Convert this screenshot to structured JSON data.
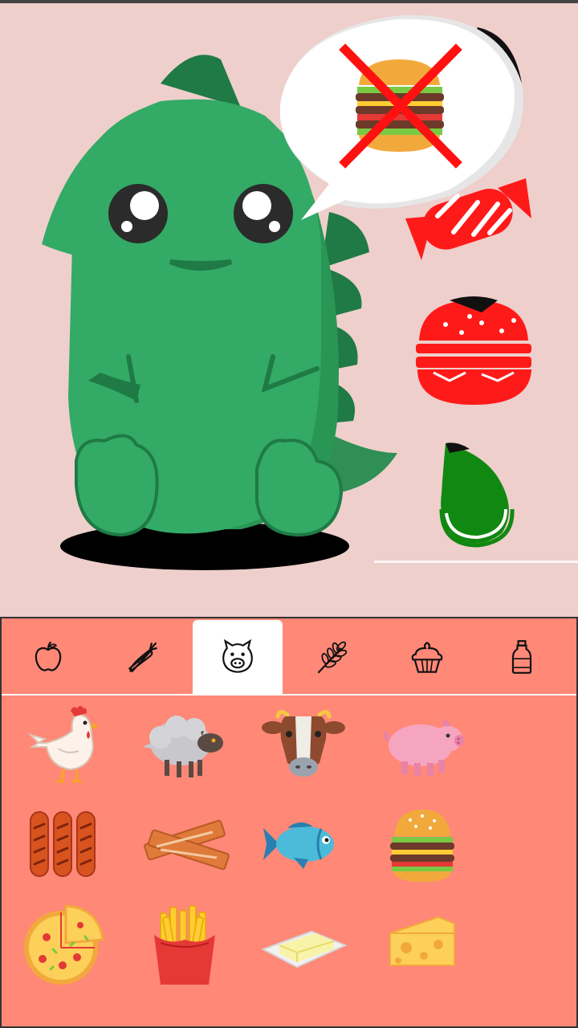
{
  "scene": {
    "character": "green-dinosaur",
    "speech_bubble_item": "burger-crossed-out",
    "side_items": [
      "dark-item-partial",
      "candy-red",
      "burger-red",
      "drop-green"
    ]
  },
  "panel": {
    "active_tab_index": 2,
    "tabs": [
      {
        "icon": "apple-icon"
      },
      {
        "icon": "carrot-icon"
      },
      {
        "icon": "pig-icon"
      },
      {
        "icon": "wheat-icon"
      },
      {
        "icon": "cupcake-icon"
      },
      {
        "icon": "bottle-icon"
      }
    ],
    "items": [
      {
        "icon": "chicken-icon"
      },
      {
        "icon": "sheep-icon"
      },
      {
        "icon": "cow-icon"
      },
      {
        "icon": "pig-food-icon"
      },
      {
        "icon": "sausages-icon"
      },
      {
        "icon": "bacon-icon"
      },
      {
        "icon": "fish-icon"
      },
      {
        "icon": "burger-icon"
      },
      {
        "icon": "pizza-icon"
      },
      {
        "icon": "fries-icon"
      },
      {
        "icon": "butter-icon"
      },
      {
        "icon": "cheese-icon"
      }
    ]
  },
  "colors": {
    "background": "#eecfcb",
    "panel": "#ff8877",
    "dinosaur": "#33aa66",
    "dinosaur_dark": "#1f7a45",
    "cross": "#ff0000"
  }
}
